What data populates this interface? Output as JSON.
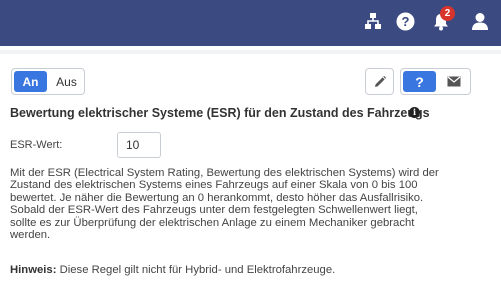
{
  "topbar": {
    "icons": [
      "hierarchy-icon",
      "help-circle-icon",
      "bell-icon",
      "user-icon"
    ],
    "notification_count": "2",
    "color": "#3b4a80"
  },
  "toggle": {
    "on_label": "An",
    "off_label": "Aus",
    "active": "An",
    "accent": "#3a76e0"
  },
  "toolbar": {
    "edit_icon": "pencil-icon",
    "help_label": "?",
    "mail_icon": "envelope-icon"
  },
  "section": {
    "title": "Bewertung elektrischer Systeme (ESR) für den Zustand des Fahrzeugs",
    "info_symbol": "i"
  },
  "esr_field": {
    "label": "ESR-Wert:",
    "value": "10"
  },
  "description_lines": [
    "Mit der ESR (Electrical System Rating, Bewertung des elektrischen Systems) wird der",
    "Zustand des elektrischen Systems eines Fahrzeugs auf einer Skala von 0 bis 100",
    "bewertet. Je näher die Bewertung an 0 herankommt, desto höher das Ausfallrisiko.",
    "Sobald der ESR-Wert des Fahrzeugs unter dem festgelegten Schwellenwert liegt,",
    "sollte es zur Überprüfung der elektrischen Anlage zu einem Mechaniker gebracht",
    "werden."
  ],
  "note": {
    "label": "Hinweis:",
    "text": "Diese Regel gilt nicht für Hybrid- und Elektrofahrzeuge."
  }
}
